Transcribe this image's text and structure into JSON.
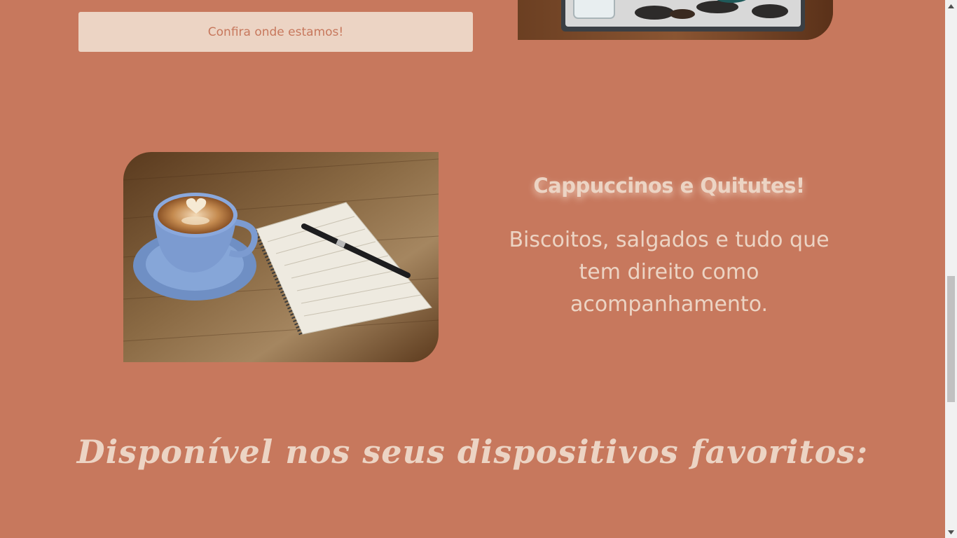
{
  "cta": {
    "label": "Confira onde estamos!"
  },
  "feature": {
    "title": "Cappuccinos e Quitutes!",
    "description": "Biscoitos, salgados e tudo que tem direito como acompanhamento."
  },
  "devices": {
    "heading": "Disponível nos seus dispositivos favoritos:"
  },
  "colors": {
    "background": "#c7785d",
    "cream": "#ecd4c4"
  },
  "icons": {
    "scroll_up": "arrow-up-icon",
    "scroll_down": "arrow-down-icon"
  }
}
